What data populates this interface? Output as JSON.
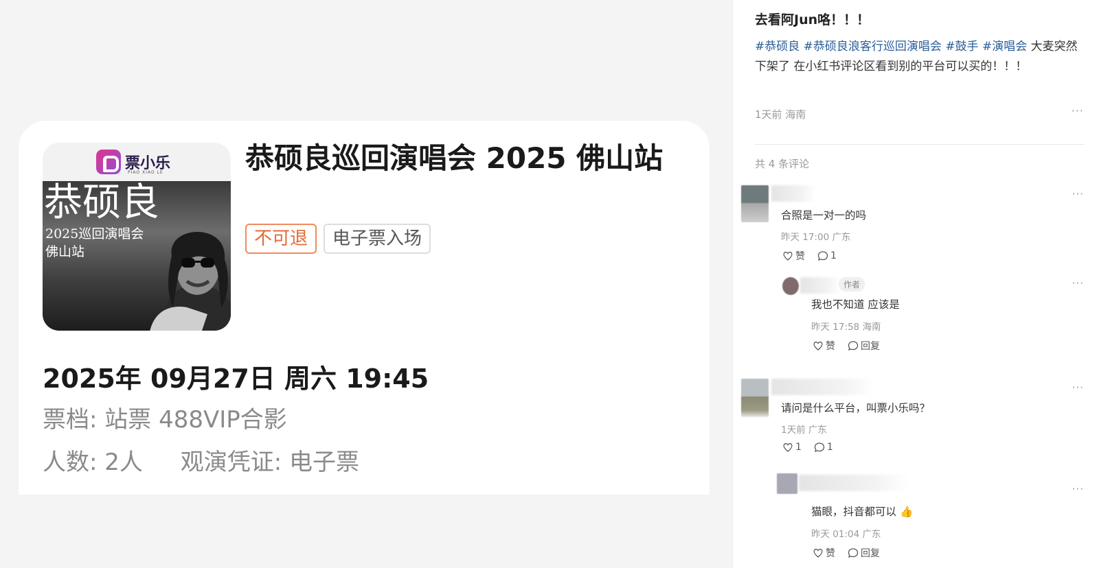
{
  "ticket": {
    "poster": {
      "logo_text": "票小乐",
      "logo_sub": "PIAO XIAO LE",
      "name": "恭硕良",
      "line2": "2025巡回演唱会",
      "line3": "佛山站"
    },
    "title": "恭硕良巡回演唱会 2025 佛山站",
    "tags": [
      "不可退",
      "电子票入场"
    ],
    "show_time": "2025年 09月27日 周六 19:45",
    "tier": "票档: 站票 488VIP合影",
    "people": "人数: 2人",
    "proof": "观演凭证: 电子票"
  },
  "post": {
    "title": "去看阿Jun咯！！！",
    "hashtags": [
      "#恭硕良",
      "#恭硕良浪客行巡回演唱会",
      "#鼓手",
      "#演唱会"
    ],
    "body_text": "大麦突然下架了 在小红书评论区看到别的平台可以买的！！！",
    "meta": "1天前 海南",
    "more": "···"
  },
  "comments_header": "共 4 条评论",
  "comments": [
    {
      "text": "合照是一对一的吗",
      "meta": "昨天 17:00 广东",
      "like_label": "赞",
      "reply_count": "1"
    },
    {
      "badge": "作者",
      "text": "我也不知道 应该是",
      "meta": "昨天 17:58 海南",
      "like_label": "赞",
      "reply_label": "回复"
    },
    {
      "text": "请问是什么平台，叫票小乐吗？",
      "meta": "1天前 广东",
      "like_count": "1",
      "reply_count": "1"
    },
    {
      "text": "猫眼，抖音都可以",
      "emoji": "👍",
      "meta": "昨天 01:04 广东",
      "like_label": "赞",
      "reply_label": "回复"
    }
  ],
  "colors": {
    "hashtag": "#2a5d9a",
    "no_refund_tag": "#e36a35",
    "background": "#f4f4f4"
  }
}
